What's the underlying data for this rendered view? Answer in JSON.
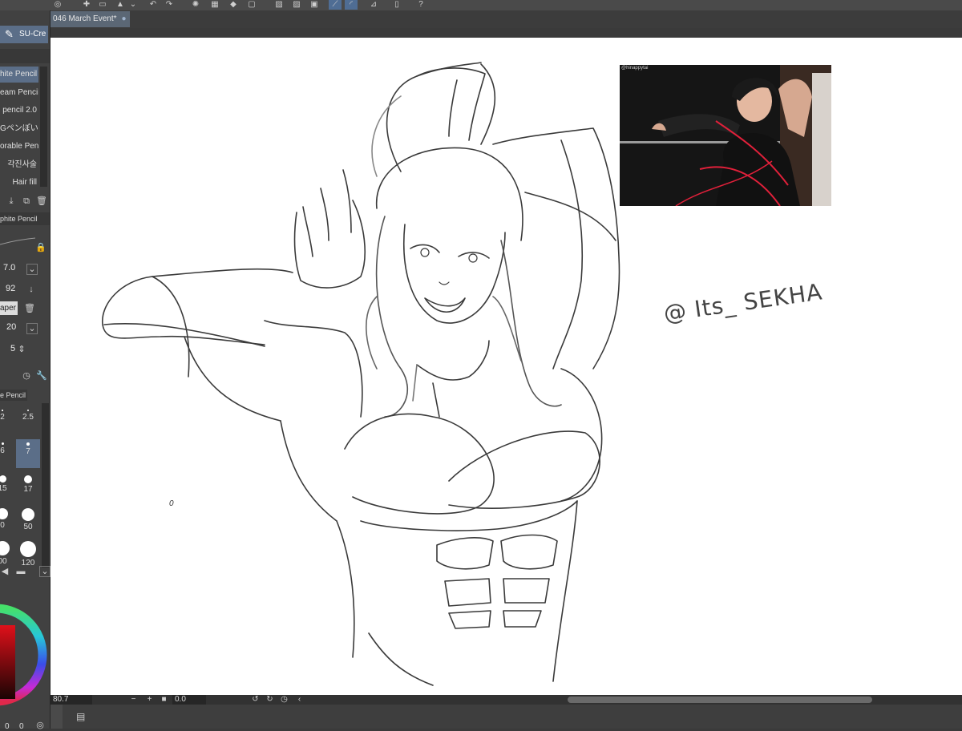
{
  "document": {
    "tab_title": "046 March Event*",
    "tab_close": "●"
  },
  "tool": {
    "current_label": "SU-Cre"
  },
  "brushes": {
    "items": [
      {
        "label": "hite Pencil",
        "selected": true
      },
      {
        "label": "eam Pencil",
        "selected": false
      },
      {
        "label": "pencil 2.0",
        "selected": false
      },
      {
        "label": "Gペンぽい",
        "selected": false
      },
      {
        "label": "orable Pen",
        "selected": false
      },
      {
        "label": "각진사술",
        "selected": false
      },
      {
        "label": "Hair fill",
        "selected": false
      }
    ]
  },
  "tool_property": {
    "title": "phite Pencil",
    "brush_size": "7.0",
    "opacity": "92",
    "paper_label": "aper",
    "texture_density": "20",
    "stabilization": "5"
  },
  "brush_size_palette": {
    "title": "e Pencil",
    "sizes": [
      {
        "label": "2",
        "selected": false
      },
      {
        "label": "2.5",
        "selected": false
      },
      {
        "label": "6",
        "selected": false
      },
      {
        "label": "7",
        "selected": true
      },
      {
        "label": "15",
        "selected": false
      },
      {
        "label": "17",
        "selected": false
      },
      {
        "label": "0",
        "selected": false
      },
      {
        "label": "50",
        "selected": false
      },
      {
        "label": "00",
        "selected": false
      },
      {
        "label": "120",
        "selected": false
      }
    ]
  },
  "color_wheel": {
    "value_a": "0",
    "value_b": "0"
  },
  "canvas": {
    "signature": "@ Its_ SEKHA",
    "stray_mark": "0",
    "reference_photo_caption": "@hinappytai"
  },
  "statusbar": {
    "zoom": "80.7",
    "minus": "−",
    "plus": "+",
    "rotation": "0.0"
  },
  "colors": {
    "accent": "#5b6e88",
    "panel": "#414141",
    "canvas": "#ffffff",
    "toolbar": "#4a4a4a"
  }
}
